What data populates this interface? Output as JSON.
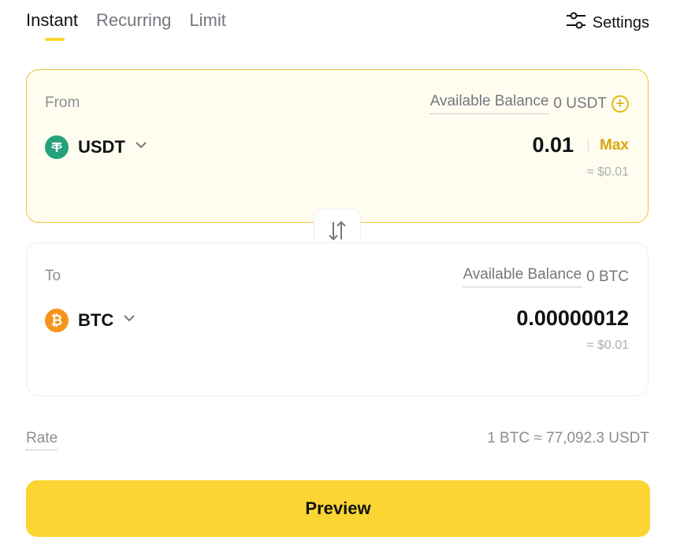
{
  "tabs": [
    {
      "label": "Instant",
      "active": true
    },
    {
      "label": "Recurring",
      "active": false
    },
    {
      "label": "Limit",
      "active": false
    }
  ],
  "settings": {
    "label": "Settings",
    "icon": "sliders-icon"
  },
  "from": {
    "label": "From",
    "balance_label": "Available Balance",
    "balance_value": "0 USDT",
    "asset": "USDT",
    "amount": "0.01",
    "max_label": "Max",
    "usd_value": "≈ $0.01"
  },
  "to": {
    "label": "To",
    "balance_label": "Available Balance",
    "balance_value": "0 BTC",
    "asset": "BTC",
    "amount": "0.00000012",
    "usd_value": "≈ $0.01"
  },
  "rate": {
    "label": "Rate",
    "value": "1 BTC ≈ 77,092.3 USDT"
  },
  "preview_button": "Preview",
  "colors": {
    "accent": "#fad533",
    "from_border": "#ebc43a",
    "usdt": "#26a17b",
    "btc": "#f7931a"
  }
}
